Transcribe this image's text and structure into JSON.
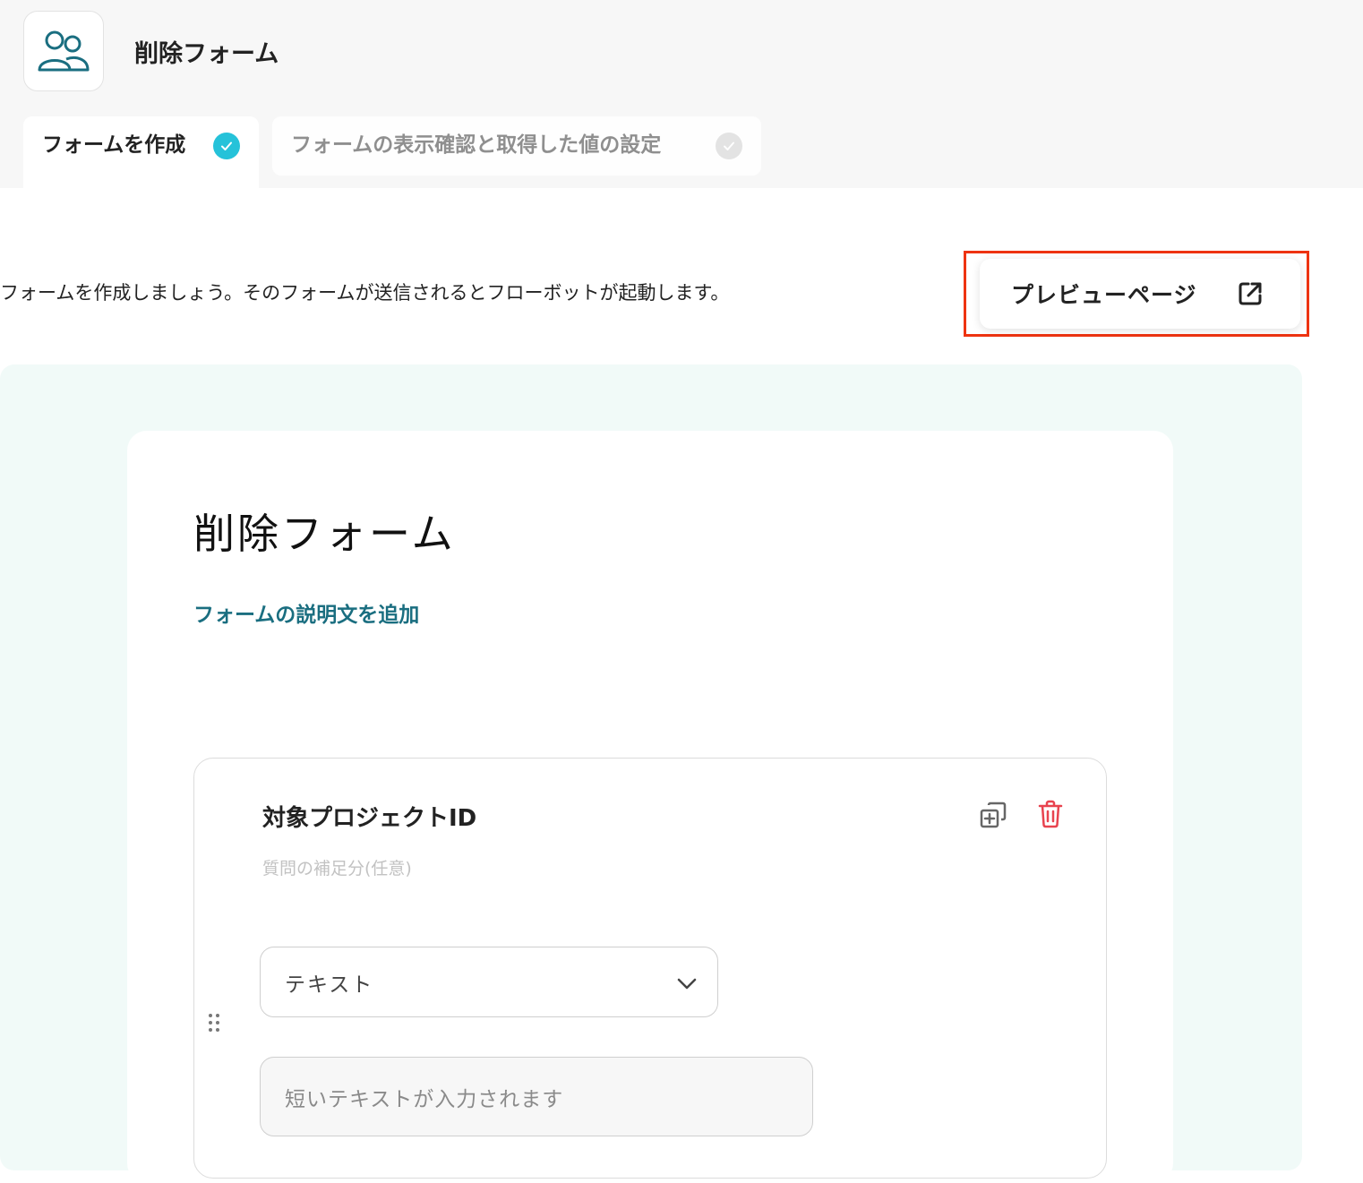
{
  "header": {
    "app_icon": "users-icon",
    "app_title": "削除フォーム"
  },
  "tabs": [
    {
      "label": "フォームを作成",
      "status": "done"
    },
    {
      "label": "フォームの表示確認と取得した値の設定",
      "status": "pending"
    }
  ],
  "intro_text": "フォームを作成しましょう。そのフォームが送信されるとフローボットが起動します。",
  "preview_button": {
    "label": "プレビューページ",
    "icon": "external-link-icon"
  },
  "form": {
    "title": "削除フォーム",
    "add_description": "フォームの説明文を追加"
  },
  "question": {
    "title": "対象プロジェクトID",
    "subtitle": "質問の補足分(任意)",
    "type_value": "テキスト",
    "answer_placeholder": "短いテキストが入力されます"
  },
  "colors": {
    "accent_teal": "#25c2d9",
    "link_teal": "#1a6e80",
    "highlight_red": "#ee3311",
    "delete_red": "#e8434f",
    "canvas_bg": "#f1faf8"
  }
}
